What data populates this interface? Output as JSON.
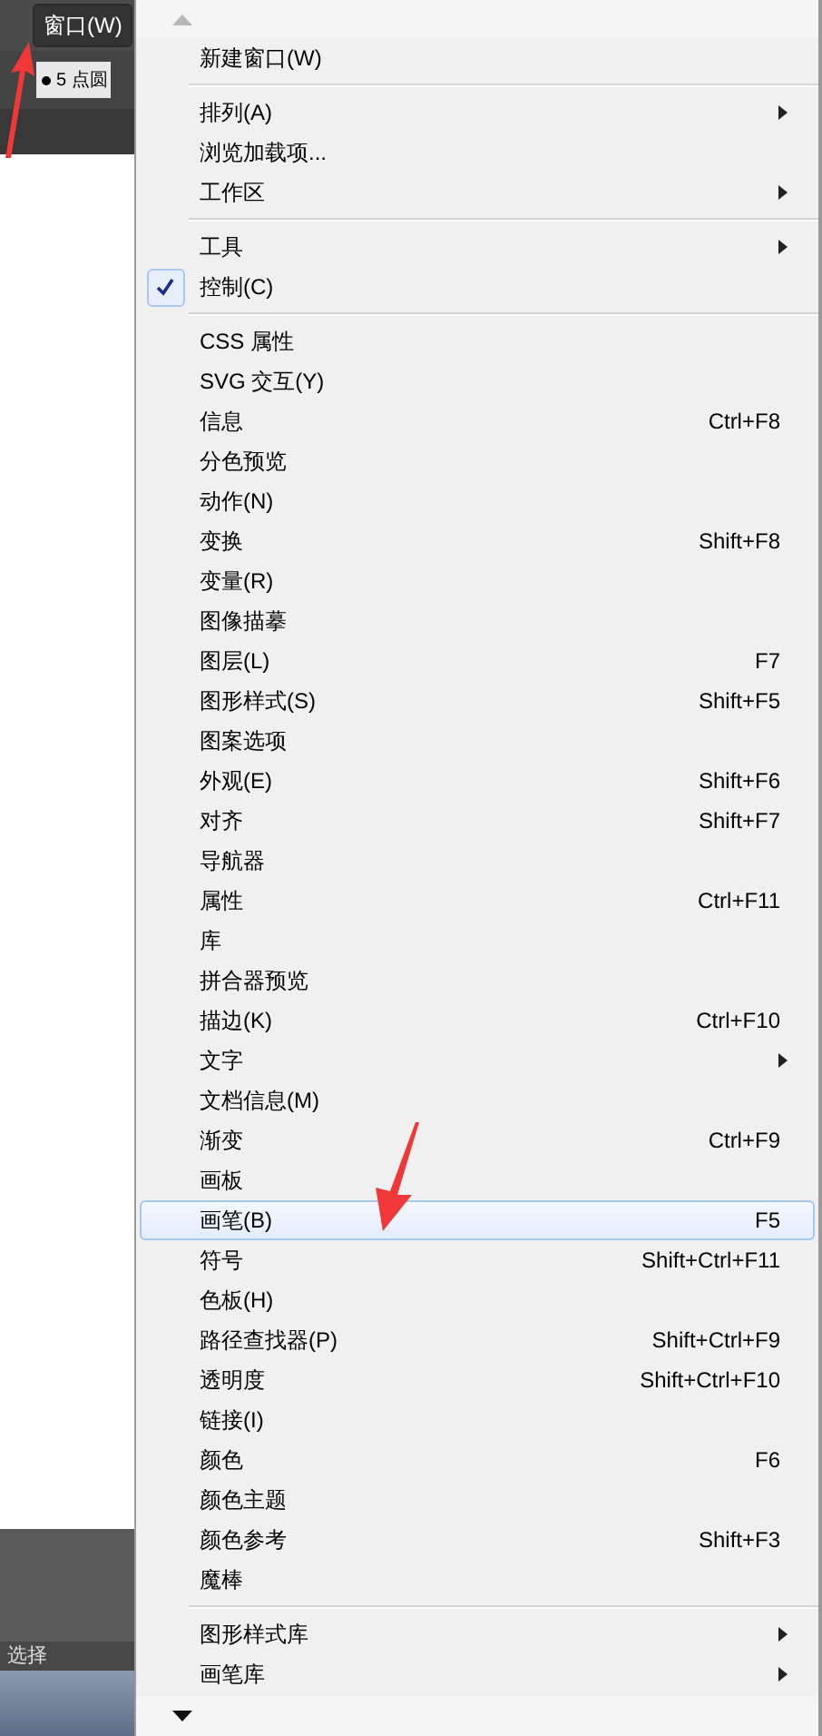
{
  "menu_bar": {
    "active_menu": "窗口(W)"
  },
  "control_bar": {
    "field": "5 点圆"
  },
  "status_bar": {
    "tool": "选择"
  },
  "menu": {
    "groups": [
      [
        {
          "label": "新建窗口(W)",
          "checked": false,
          "submenu": false,
          "selected": false
        }
      ],
      [
        {
          "label": "排列(A)",
          "checked": false,
          "submenu": true,
          "selected": false
        },
        {
          "label": "浏览加载项...",
          "checked": false,
          "submenu": false,
          "selected": false
        },
        {
          "label": "工作区",
          "checked": false,
          "submenu": true,
          "selected": false
        }
      ],
      [
        {
          "label": "工具",
          "checked": false,
          "submenu": true,
          "selected": false
        },
        {
          "label": "控制(C)",
          "checked": true,
          "submenu": false,
          "selected": false
        }
      ],
      [
        {
          "label": "CSS 属性",
          "checked": false,
          "submenu": false,
          "selected": false
        },
        {
          "label": "SVG 交互(Y)",
          "checked": false,
          "submenu": false,
          "selected": false
        },
        {
          "label": "信息",
          "shortcut": "Ctrl+F8",
          "checked": false,
          "submenu": false,
          "selected": false
        },
        {
          "label": "分色预览",
          "checked": false,
          "submenu": false,
          "selected": false
        },
        {
          "label": "动作(N)",
          "checked": false,
          "submenu": false,
          "selected": false
        },
        {
          "label": "变换",
          "shortcut": "Shift+F8",
          "checked": false,
          "submenu": false,
          "selected": false
        },
        {
          "label": "变量(R)",
          "checked": false,
          "submenu": false,
          "selected": false
        },
        {
          "label": "图像描摹",
          "checked": false,
          "submenu": false,
          "selected": false
        },
        {
          "label": "图层(L)",
          "shortcut": "F7",
          "checked": false,
          "submenu": false,
          "selected": false
        },
        {
          "label": "图形样式(S)",
          "shortcut": "Shift+F5",
          "checked": false,
          "submenu": false,
          "selected": false
        },
        {
          "label": "图案选项",
          "checked": false,
          "submenu": false,
          "selected": false
        },
        {
          "label": "外观(E)",
          "shortcut": "Shift+F6",
          "checked": false,
          "submenu": false,
          "selected": false
        },
        {
          "label": "对齐",
          "shortcut": "Shift+F7",
          "checked": false,
          "submenu": false,
          "selected": false
        },
        {
          "label": "导航器",
          "checked": false,
          "submenu": false,
          "selected": false
        },
        {
          "label": "属性",
          "shortcut": "Ctrl+F11",
          "checked": false,
          "submenu": false,
          "selected": false
        },
        {
          "label": "库",
          "checked": false,
          "submenu": false,
          "selected": false
        },
        {
          "label": "拼合器预览",
          "checked": false,
          "submenu": false,
          "selected": false
        },
        {
          "label": "描边(K)",
          "shortcut": "Ctrl+F10",
          "checked": false,
          "submenu": false,
          "selected": false
        },
        {
          "label": "文字",
          "checked": false,
          "submenu": true,
          "selected": false
        },
        {
          "label": "文档信息(M)",
          "checked": false,
          "submenu": false,
          "selected": false
        },
        {
          "label": "渐变",
          "shortcut": "Ctrl+F9",
          "checked": false,
          "submenu": false,
          "selected": false
        },
        {
          "label": "画板",
          "checked": false,
          "submenu": false,
          "selected": false
        },
        {
          "label": "画笔(B)",
          "shortcut": "F5",
          "checked": false,
          "submenu": false,
          "selected": true
        },
        {
          "label": "符号",
          "shortcut": "Shift+Ctrl+F11",
          "checked": false,
          "submenu": false,
          "selected": false
        },
        {
          "label": "色板(H)",
          "checked": false,
          "submenu": false,
          "selected": false
        },
        {
          "label": "路径查找器(P)",
          "shortcut": "Shift+Ctrl+F9",
          "checked": false,
          "submenu": false,
          "selected": false
        },
        {
          "label": "透明度",
          "shortcut": "Shift+Ctrl+F10",
          "checked": false,
          "submenu": false,
          "selected": false
        },
        {
          "label": "链接(I)",
          "checked": false,
          "submenu": false,
          "selected": false
        },
        {
          "label": "颜色",
          "shortcut": "F6",
          "checked": false,
          "submenu": false,
          "selected": false
        },
        {
          "label": "颜色主题",
          "checked": false,
          "submenu": false,
          "selected": false
        },
        {
          "label": "颜色参考",
          "shortcut": "Shift+F3",
          "checked": false,
          "submenu": false,
          "selected": false
        },
        {
          "label": "魔棒",
          "checked": false,
          "submenu": false,
          "selected": false
        }
      ],
      [
        {
          "label": "图形样式库",
          "checked": false,
          "submenu": true,
          "selected": false
        },
        {
          "label": "画笔库",
          "checked": false,
          "submenu": true,
          "selected": false
        }
      ]
    ]
  }
}
